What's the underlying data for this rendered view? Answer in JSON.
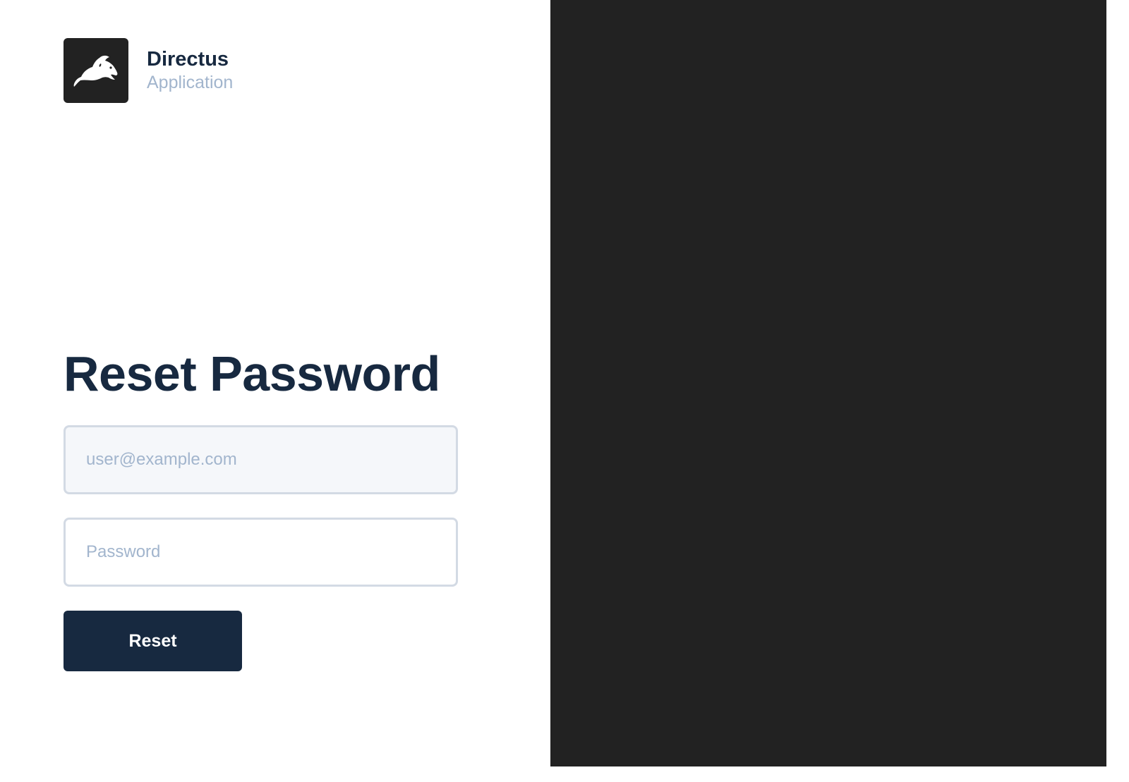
{
  "brand": {
    "title": "Directus",
    "subtitle": "Application",
    "logo_icon": "rabbit-icon",
    "logo_bg": "#222222"
  },
  "form": {
    "heading": "Reset Password",
    "email_placeholder": "user@example.com",
    "password_placeholder": "Password",
    "submit_label": "Reset"
  },
  "colors": {
    "primary": "#172940",
    "muted": "#a2b5cd",
    "border": "#d3dae4",
    "right_panel": "#222222"
  }
}
